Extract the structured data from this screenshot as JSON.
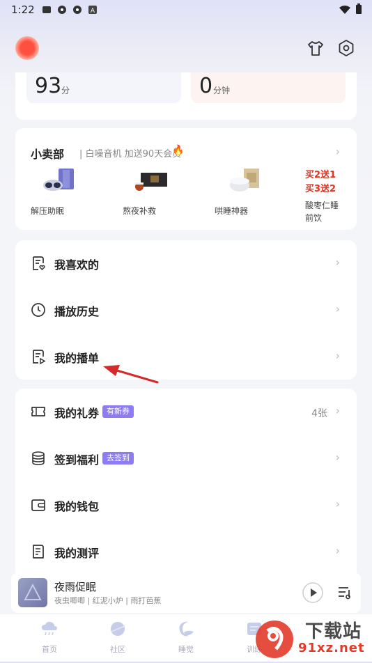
{
  "status_bar": {
    "time": "1:22"
  },
  "stats": {
    "score_value": "93",
    "score_unit": "分",
    "minutes_value": "0",
    "minutes_unit": "分钟"
  },
  "shop": {
    "title": "小卖部",
    "subtitle": "| 白噪音机 加送90天会员",
    "products": [
      {
        "label": "解压助眠",
        "icon": "eye-mask-product-icon"
      },
      {
        "label": "熬夜补救",
        "icon": "gift-box-product-icon"
      },
      {
        "label": "哄睡神器",
        "icon": "sound-machine-product-icon"
      },
      {
        "label": "酸枣仁睡前饮",
        "promo_line1": "买2送1",
        "promo_line2": "买3送2",
        "icon": "promo-text"
      }
    ]
  },
  "menu1": [
    {
      "label": "我喜欢的",
      "icon": "favorites-list-icon"
    },
    {
      "label": "播放历史",
      "icon": "clock-icon"
    },
    {
      "label": "我的播单",
      "icon": "playlist-icon"
    }
  ],
  "menu2": [
    {
      "label": "我的礼券",
      "badge": "有新券",
      "extra": "4张",
      "icon": "ticket-icon"
    },
    {
      "label": "签到福利",
      "badge": "去签到",
      "icon": "coins-icon"
    },
    {
      "label": "我的钱包",
      "icon": "wallet-icon"
    },
    {
      "label": "我的测评",
      "icon": "assessment-icon"
    }
  ],
  "player": {
    "title": "夜雨促眠",
    "subtitle": "夜虫唧唧 | 红泥小炉 | 雨打芭蕉"
  },
  "tabs": [
    {
      "label": "首页",
      "icon": "rain-cloud-icon"
    },
    {
      "label": "社区",
      "icon": "planet-icon"
    },
    {
      "label": "睡觉",
      "icon": "moon-icon"
    },
    {
      "label": "训练",
      "icon": "training-icon"
    }
  ],
  "watermark": {
    "line1": "下载站",
    "line2": "91xz.net"
  },
  "colors": {
    "accent": "#8e7cf5",
    "promo": "#e8311f",
    "annotation_arrow": "#d42a2a"
  }
}
